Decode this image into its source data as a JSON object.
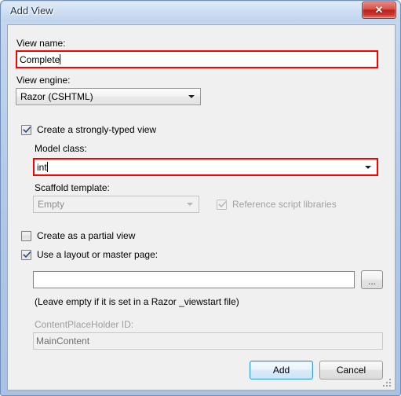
{
  "window": {
    "title": "Add View",
    "close_glyph": "✕"
  },
  "form": {
    "view_name_label": "View name:",
    "view_name_value": "Complete",
    "view_engine_label": "View engine:",
    "view_engine_value": "Razor (CSHTML)",
    "strongly_typed_label": "Create a strongly-typed view",
    "strongly_typed_checked": true,
    "model_class_label": "Model class:",
    "model_class_value": "int",
    "scaffold_template_label": "Scaffold template:",
    "scaffold_template_value": "Empty",
    "reference_script_label": "Reference script libraries",
    "reference_script_checked": true,
    "partial_view_label": "Create as a partial view",
    "partial_view_checked": false,
    "layout_page_label": "Use a layout or master page:",
    "layout_page_checked": true,
    "layout_path_value": "",
    "browse_label": "...",
    "layout_hint": "(Leave empty if it is set in a Razor _viewstart file)",
    "content_placeholder_label": "ContentPlaceHolder ID:",
    "content_placeholder_value": "MainContent"
  },
  "footer": {
    "add_label": "Add",
    "cancel_label": "Cancel"
  },
  "colors": {
    "highlight_red": "#ff0000",
    "default_button_blue": "#2f9ad6",
    "titlebar_blue": "#bed3ed"
  }
}
